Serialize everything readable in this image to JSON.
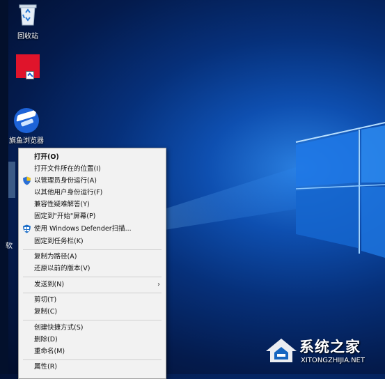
{
  "desktop": {
    "recycle_bin_label": "回收站",
    "browser_label": "旗鱼浏览器",
    "side_text": "软"
  },
  "context_menu": {
    "items": [
      {
        "label": "打开(O)",
        "bold": true
      },
      {
        "label": "打开文件所在的位置(I)"
      },
      {
        "label": "以管理员身份运行(A)",
        "icon": "shield-icon"
      },
      {
        "label": "以其他用户身份运行(F)"
      },
      {
        "label": "兼容性疑难解答(Y)"
      },
      {
        "label": "固定到\"开始\"屏幕(P)"
      },
      {
        "label": "使用 Windows Defender扫描...",
        "icon": "defender-icon"
      },
      {
        "label": "固定到任务栏(K)"
      },
      {
        "label": "复制为路径(A)"
      },
      {
        "label": "还原以前的版本(V)"
      },
      {
        "label": "发送到(N)",
        "submenu": true
      },
      {
        "label": "剪切(T)"
      },
      {
        "label": "复制(C)"
      },
      {
        "label": "创建快捷方式(S)"
      },
      {
        "label": "删除(D)"
      },
      {
        "label": "重命名(M)"
      },
      {
        "label": "属性(R)"
      }
    ],
    "submenu_arrow": "›"
  },
  "watermark": {
    "name": "系统之家",
    "url": "XITONGZHIJIA.NET"
  },
  "colors": {
    "desktop_blue": "#0e4fb0",
    "menu_bg": "#f2f2f2",
    "red_icon": "#e0142b"
  }
}
